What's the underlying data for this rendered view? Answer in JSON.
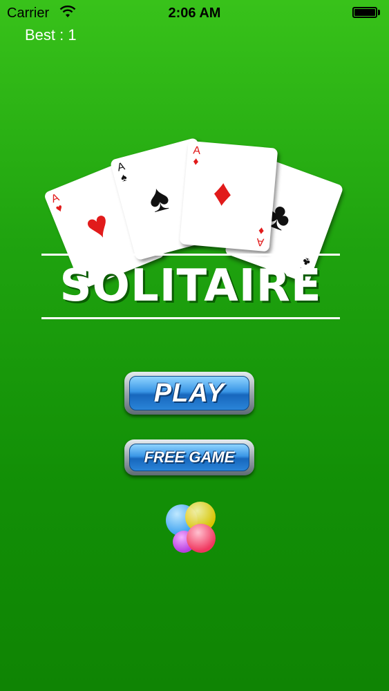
{
  "status_bar": {
    "carrier": "Carrier",
    "time": "2:06 AM"
  },
  "best_label": "Best : 1",
  "logo": {
    "title": "SOLITAIRE",
    "cards": [
      {
        "rank": "A",
        "suit": "♥",
        "color": "#e11b1b"
      },
      {
        "rank": "A",
        "suit": "♠",
        "color": "#111111"
      },
      {
        "rank": "A",
        "suit": "♦",
        "color": "#e11b1b"
      },
      {
        "rank": "A",
        "suit": "♣",
        "color": "#111111"
      }
    ]
  },
  "buttons": {
    "play": "PLAY",
    "free_game": "FREE GAME"
  },
  "icons": {
    "game_center": "game-center-icon"
  },
  "colors": {
    "felt_green": "#1fa30f",
    "button_blue": "#2a84d8"
  }
}
